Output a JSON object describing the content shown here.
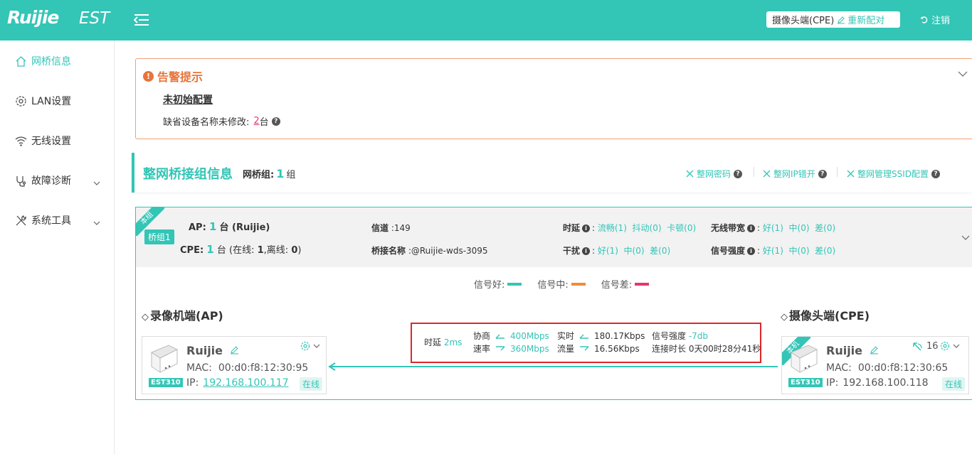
{
  "header": {
    "logo": "Ruijie",
    "product": "EST",
    "device_label": "摄像头端(CPE)",
    "repair_label": "重新配对",
    "logout_label": "注销"
  },
  "sidebar": {
    "items": [
      {
        "label": "网桥信息",
        "icon": "home-icon",
        "active": true
      },
      {
        "label": "LAN设置",
        "icon": "gear-icon"
      },
      {
        "label": "无线设置",
        "icon": "wifi-icon"
      },
      {
        "label": "故障诊断",
        "icon": "stethoscope-icon"
      },
      {
        "label": "系统工具",
        "icon": "tools-icon"
      }
    ]
  },
  "alert": {
    "title": "告警提示",
    "subtitle": "未初始配置",
    "line_label": "缺省设备名称未修改:",
    "line_count": "2",
    "line_unit": "台"
  },
  "section": {
    "title": "整网桥接组信息",
    "groups_label": "网桥组:",
    "groups_count": "1",
    "groups_unit": "组",
    "links": [
      "整网密码",
      "整网IP错开",
      "整网管理SSID配置"
    ]
  },
  "group": {
    "ribbon": "本组",
    "tag": "桥组1",
    "ap_label": "AP:",
    "ap_count": "1",
    "ap_rest": "台 (Ruijie)",
    "cpe_label": "CPE:",
    "cpe_count": "1",
    "cpe_rest_a": "台 (在线:",
    "cpe_online": "1",
    "cpe_rest_b": ",离线:",
    "cpe_offline": "0",
    "cpe_rest_c": ")",
    "channel_label": "信道",
    "channel_value": ":149",
    "bridge_name_label": "桥接名称",
    "bridge_name_value": ":@Ruijie-wds-3095",
    "latency_label": "时延",
    "latency_vals": [
      "流畅(1)",
      "抖动(0)",
      "卡顿(0)"
    ],
    "interference_label": "干扰",
    "interference_vals": [
      "好(1)",
      "中(0)",
      "差(0)"
    ],
    "bandwidth_label": "无线带宽",
    "bandwidth_vals": [
      "好(1)",
      "中(0)",
      "差(0)"
    ],
    "signal_label": "信号强度",
    "signal_vals": [
      "好(1)",
      "中(0)",
      "差(0)"
    ]
  },
  "legend": [
    {
      "label": "信号好:",
      "color": "#33c5b6"
    },
    {
      "label": "信号中:",
      "color": "#f08c3a"
    },
    {
      "label": "信号差:",
      "color": "#e8356a"
    }
  ],
  "ap": {
    "title": "录像机端(AP)",
    "name": "Ruijie",
    "model": "EST310",
    "mac_label": "MAC:",
    "mac": "00:d0:f8:12:30:95",
    "ip_label": "IP:",
    "ip": "192.168.100.117",
    "status": "在线"
  },
  "cpe": {
    "title": "摄像头端(CPE)",
    "ribbon": "本机",
    "name": "Ruijie",
    "model": "EST310",
    "mac_label": "MAC:",
    "mac": "00:d0:f8:12:30:65",
    "ip_label": "IP:",
    "ip": "192.168.100.118",
    "status": "在线",
    "wifi_count": "16"
  },
  "link_stats": {
    "latency_label": "时延",
    "latency": "2ms",
    "negotiate_label": "协商",
    "negotiate_up": "400Mbps",
    "rate_label": "速率",
    "negotiate_down": "360Mbps",
    "realtime_label": "实时",
    "realtime_up": "180.17Kbps",
    "flow_label": "流量",
    "realtime_down": "16.56Kbps",
    "signal_label": "信号强度",
    "signal": "-7db",
    "uptime_label": "连接时长",
    "uptime": "0天00时28分41秒"
  }
}
